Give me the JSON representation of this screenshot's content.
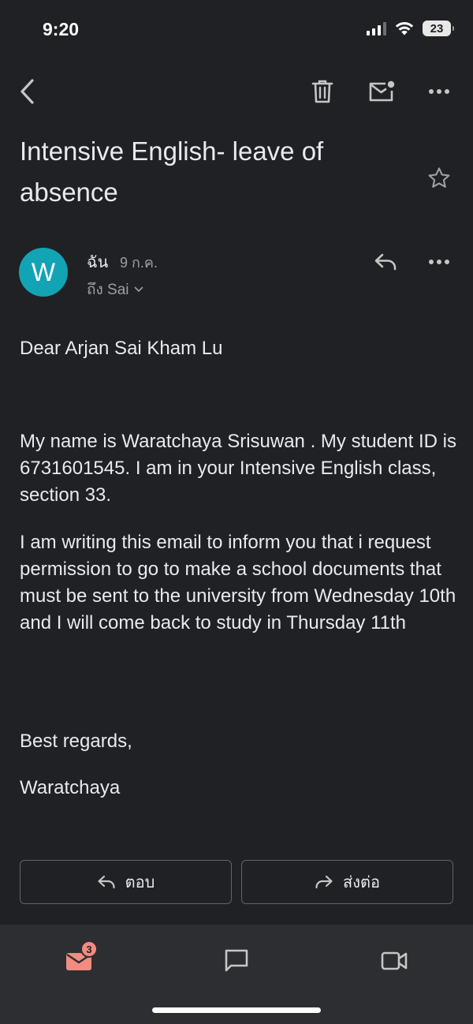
{
  "status_bar": {
    "time": "9:20",
    "battery": "23"
  },
  "toolbar": {
    "back_icon": "chevron-left-icon",
    "delete_icon": "trash-icon",
    "mark_unread_icon": "mail-unread-icon",
    "more_icon": "more-horizontal-icon"
  },
  "email": {
    "subject": "Intensive English- leave of absence",
    "sender_initial": "W",
    "sender_name": "ฉัน",
    "date": "9 ก.ค.",
    "recipient": "ถึง Sai",
    "greeting": "Dear Arjan Sai Kham Lu",
    "paragraph1": "My name is Waratchaya Srisuwan . My student ID is 6731601545. I am in your Intensive English class, section 33.",
    "paragraph2": "I am writing this email to inform you that i request permission to go to make a school documents that must be sent to the university from Wednesday 10th and I will come back to study in Thursday  11th",
    "closing": "Best regards,",
    "signature": "Waratchaya"
  },
  "actions": {
    "reply_label": "ตอบ",
    "forward_label": "ส่งต่อ"
  },
  "bottom_nav": {
    "mail_badge": "3",
    "items": [
      "mail-icon",
      "chat-icon",
      "video-icon"
    ]
  },
  "colors": {
    "background": "#202124",
    "avatar": "#12a4b5",
    "badge": "#f28b82",
    "mail_active": "#f28b82",
    "nav_background": "#2d2e31"
  }
}
